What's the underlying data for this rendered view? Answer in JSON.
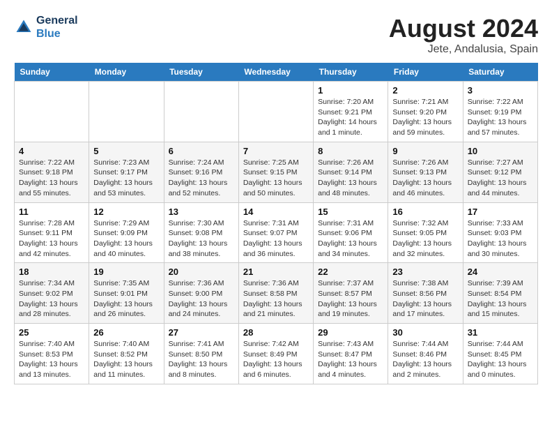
{
  "header": {
    "logo_line1": "General",
    "logo_line2": "Blue",
    "title": "August 2024",
    "subtitle": "Jete, Andalusia, Spain"
  },
  "days_of_week": [
    "Sunday",
    "Monday",
    "Tuesday",
    "Wednesday",
    "Thursday",
    "Friday",
    "Saturday"
  ],
  "weeks": [
    [
      {
        "day": "",
        "details": ""
      },
      {
        "day": "",
        "details": ""
      },
      {
        "day": "",
        "details": ""
      },
      {
        "day": "",
        "details": ""
      },
      {
        "day": "1",
        "details": "Sunrise: 7:20 AM\nSunset: 9:21 PM\nDaylight: 14 hours\nand 1 minute."
      },
      {
        "day": "2",
        "details": "Sunrise: 7:21 AM\nSunset: 9:20 PM\nDaylight: 13 hours\nand 59 minutes."
      },
      {
        "day": "3",
        "details": "Sunrise: 7:22 AM\nSunset: 9:19 PM\nDaylight: 13 hours\nand 57 minutes."
      }
    ],
    [
      {
        "day": "4",
        "details": "Sunrise: 7:22 AM\nSunset: 9:18 PM\nDaylight: 13 hours\nand 55 minutes."
      },
      {
        "day": "5",
        "details": "Sunrise: 7:23 AM\nSunset: 9:17 PM\nDaylight: 13 hours\nand 53 minutes."
      },
      {
        "day": "6",
        "details": "Sunrise: 7:24 AM\nSunset: 9:16 PM\nDaylight: 13 hours\nand 52 minutes."
      },
      {
        "day": "7",
        "details": "Sunrise: 7:25 AM\nSunset: 9:15 PM\nDaylight: 13 hours\nand 50 minutes."
      },
      {
        "day": "8",
        "details": "Sunrise: 7:26 AM\nSunset: 9:14 PM\nDaylight: 13 hours\nand 48 minutes."
      },
      {
        "day": "9",
        "details": "Sunrise: 7:26 AM\nSunset: 9:13 PM\nDaylight: 13 hours\nand 46 minutes."
      },
      {
        "day": "10",
        "details": "Sunrise: 7:27 AM\nSunset: 9:12 PM\nDaylight: 13 hours\nand 44 minutes."
      }
    ],
    [
      {
        "day": "11",
        "details": "Sunrise: 7:28 AM\nSunset: 9:11 PM\nDaylight: 13 hours\nand 42 minutes."
      },
      {
        "day": "12",
        "details": "Sunrise: 7:29 AM\nSunset: 9:09 PM\nDaylight: 13 hours\nand 40 minutes."
      },
      {
        "day": "13",
        "details": "Sunrise: 7:30 AM\nSunset: 9:08 PM\nDaylight: 13 hours\nand 38 minutes."
      },
      {
        "day": "14",
        "details": "Sunrise: 7:31 AM\nSunset: 9:07 PM\nDaylight: 13 hours\nand 36 minutes."
      },
      {
        "day": "15",
        "details": "Sunrise: 7:31 AM\nSunset: 9:06 PM\nDaylight: 13 hours\nand 34 minutes."
      },
      {
        "day": "16",
        "details": "Sunrise: 7:32 AM\nSunset: 9:05 PM\nDaylight: 13 hours\nand 32 minutes."
      },
      {
        "day": "17",
        "details": "Sunrise: 7:33 AM\nSunset: 9:03 PM\nDaylight: 13 hours\nand 30 minutes."
      }
    ],
    [
      {
        "day": "18",
        "details": "Sunrise: 7:34 AM\nSunset: 9:02 PM\nDaylight: 13 hours\nand 28 minutes."
      },
      {
        "day": "19",
        "details": "Sunrise: 7:35 AM\nSunset: 9:01 PM\nDaylight: 13 hours\nand 26 minutes."
      },
      {
        "day": "20",
        "details": "Sunrise: 7:36 AM\nSunset: 9:00 PM\nDaylight: 13 hours\nand 24 minutes."
      },
      {
        "day": "21",
        "details": "Sunrise: 7:36 AM\nSunset: 8:58 PM\nDaylight: 13 hours\nand 21 minutes."
      },
      {
        "day": "22",
        "details": "Sunrise: 7:37 AM\nSunset: 8:57 PM\nDaylight: 13 hours\nand 19 minutes."
      },
      {
        "day": "23",
        "details": "Sunrise: 7:38 AM\nSunset: 8:56 PM\nDaylight: 13 hours\nand 17 minutes."
      },
      {
        "day": "24",
        "details": "Sunrise: 7:39 AM\nSunset: 8:54 PM\nDaylight: 13 hours\nand 15 minutes."
      }
    ],
    [
      {
        "day": "25",
        "details": "Sunrise: 7:40 AM\nSunset: 8:53 PM\nDaylight: 13 hours\nand 13 minutes."
      },
      {
        "day": "26",
        "details": "Sunrise: 7:40 AM\nSunset: 8:52 PM\nDaylight: 13 hours\nand 11 minutes."
      },
      {
        "day": "27",
        "details": "Sunrise: 7:41 AM\nSunset: 8:50 PM\nDaylight: 13 hours\nand 8 minutes."
      },
      {
        "day": "28",
        "details": "Sunrise: 7:42 AM\nSunset: 8:49 PM\nDaylight: 13 hours\nand 6 minutes."
      },
      {
        "day": "29",
        "details": "Sunrise: 7:43 AM\nSunset: 8:47 PM\nDaylight: 13 hours\nand 4 minutes."
      },
      {
        "day": "30",
        "details": "Sunrise: 7:44 AM\nSunset: 8:46 PM\nDaylight: 13 hours\nand 2 minutes."
      },
      {
        "day": "31",
        "details": "Sunrise: 7:44 AM\nSunset: 8:45 PM\nDaylight: 13 hours\nand 0 minutes."
      }
    ]
  ]
}
